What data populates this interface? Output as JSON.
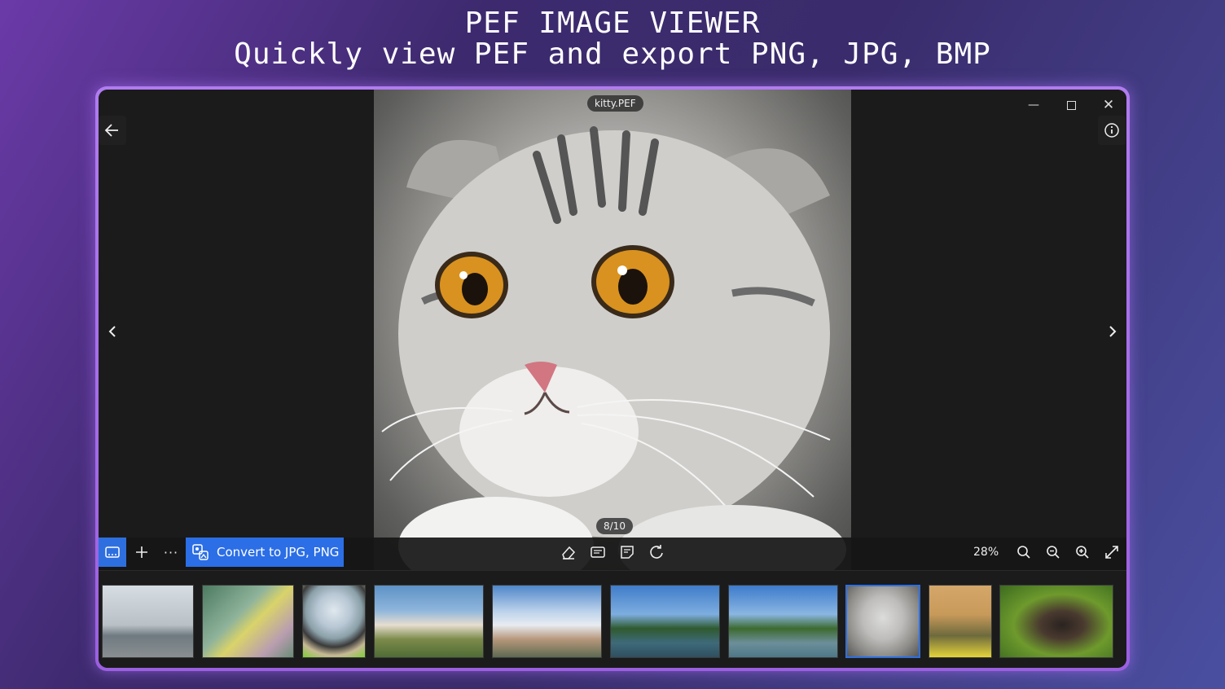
{
  "banner": {
    "line1": "PEF IMAGE VIEWER",
    "line2": "Quickly view PEF and export PNG, JPG, BMP"
  },
  "viewer": {
    "file_name": "kitty.PEF",
    "counter": "8/10",
    "zoom": "28%",
    "convert_label": "Convert to JPG, PNG",
    "accent_color": "#2e6fe0"
  },
  "icons": {
    "back": "arrow-left-icon",
    "info": "info-icon",
    "prev": "chevron-left-icon",
    "next": "chevron-right-icon",
    "minimize": "minimize-icon",
    "maximize": "maximize-icon",
    "close": "close-icon"
  },
  "filmstrip": {
    "count": 10,
    "selected_index": 7
  }
}
